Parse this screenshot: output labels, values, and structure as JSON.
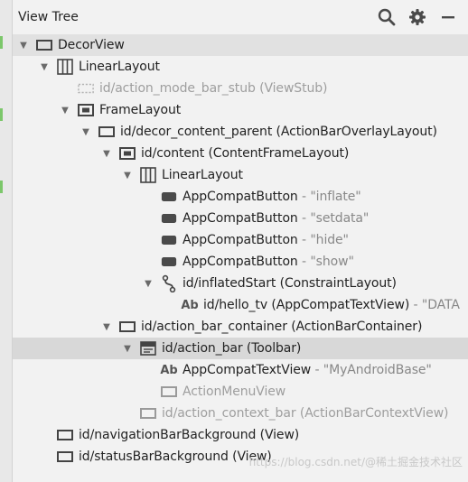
{
  "panel": {
    "title": "View Tree"
  },
  "header_icons": [
    "search-icon",
    "gear-icon",
    "minimize-icon"
  ],
  "tree": [
    {
      "label": "DecorView",
      "suffix": "",
      "value": "",
      "icon": "frame-icon",
      "expanded": true,
      "dim": false
    },
    {
      "label": "LinearLayout",
      "suffix": "",
      "value": "",
      "icon": "columns-icon",
      "expanded": true,
      "dim": false
    },
    {
      "label": "id/action_mode_bar_stub (ViewStub)",
      "suffix": "",
      "value": "",
      "icon": "dashed-icon",
      "expanded": null,
      "dim": true
    },
    {
      "label": "FrameLayout",
      "suffix": "",
      "value": "",
      "icon": "frame-inner-icon",
      "expanded": true,
      "dim": false
    },
    {
      "label": "id/decor_content_parent (ActionBarOverlayLayout)",
      "suffix": "",
      "value": "",
      "icon": "frame-icon",
      "expanded": true,
      "dim": false
    },
    {
      "label": "id/content (ContentFrameLayout)",
      "suffix": "",
      "value": "",
      "icon": "frame-inner-icon",
      "expanded": true,
      "dim": false
    },
    {
      "label": "LinearLayout",
      "suffix": "",
      "value": "",
      "icon": "columns-icon",
      "expanded": true,
      "dim": false
    },
    {
      "label": "AppCompatButton",
      "suffix": " - ",
      "value": "\"inflate\"",
      "icon": "button-icon",
      "expanded": null,
      "dim": false
    },
    {
      "label": "AppCompatButton",
      "suffix": " - ",
      "value": "\"setdata\"",
      "icon": "button-icon",
      "expanded": null,
      "dim": false
    },
    {
      "label": "AppCompatButton",
      "suffix": " - ",
      "value": "\"hide\"",
      "icon": "button-icon",
      "expanded": null,
      "dim": false
    },
    {
      "label": "AppCompatButton",
      "suffix": " - ",
      "value": "\"show\"",
      "icon": "button-icon",
      "expanded": null,
      "dim": false
    },
    {
      "label": "id/inflatedStart (ConstraintLayout)",
      "suffix": "",
      "value": "",
      "icon": "constraint-icon",
      "expanded": true,
      "dim": false
    },
    {
      "label": "id/hello_tv (AppCompatTextView)",
      "suffix": " - ",
      "value": "\"DATA",
      "icon": "ab-icon",
      "expanded": null,
      "dim": false
    },
    {
      "label": "id/action_bar_container (ActionBarContainer)",
      "suffix": "",
      "value": "",
      "icon": "frame-icon",
      "expanded": true,
      "dim": false
    },
    {
      "label": "id/action_bar (Toolbar)",
      "suffix": "",
      "value": "",
      "icon": "toolbar-icon",
      "expanded": true,
      "dim": false
    },
    {
      "label": "AppCompatTextView",
      "suffix": " - ",
      "value": "\"MyAndroidBase\"",
      "icon": "ab-icon",
      "expanded": null,
      "dim": false
    },
    {
      "label": "ActionMenuView",
      "suffix": "",
      "value": "",
      "icon": "frame-icon",
      "expanded": null,
      "dim": true
    },
    {
      "label": "id/action_context_bar (ActionBarContextView)",
      "suffix": "",
      "value": "",
      "icon": "frame-icon",
      "expanded": null,
      "dim": true
    },
    {
      "label": "id/navigationBarBackground (View)",
      "suffix": "",
      "value": "",
      "icon": "frame-icon",
      "expanded": null,
      "dim": false
    },
    {
      "label": "id/statusBarBackground (View)",
      "suffix": "",
      "value": "",
      "icon": "frame-icon",
      "expanded": null,
      "dim": false
    }
  ],
  "watermark": "https://blog.csdn.net/@稀土掘金技术社区"
}
